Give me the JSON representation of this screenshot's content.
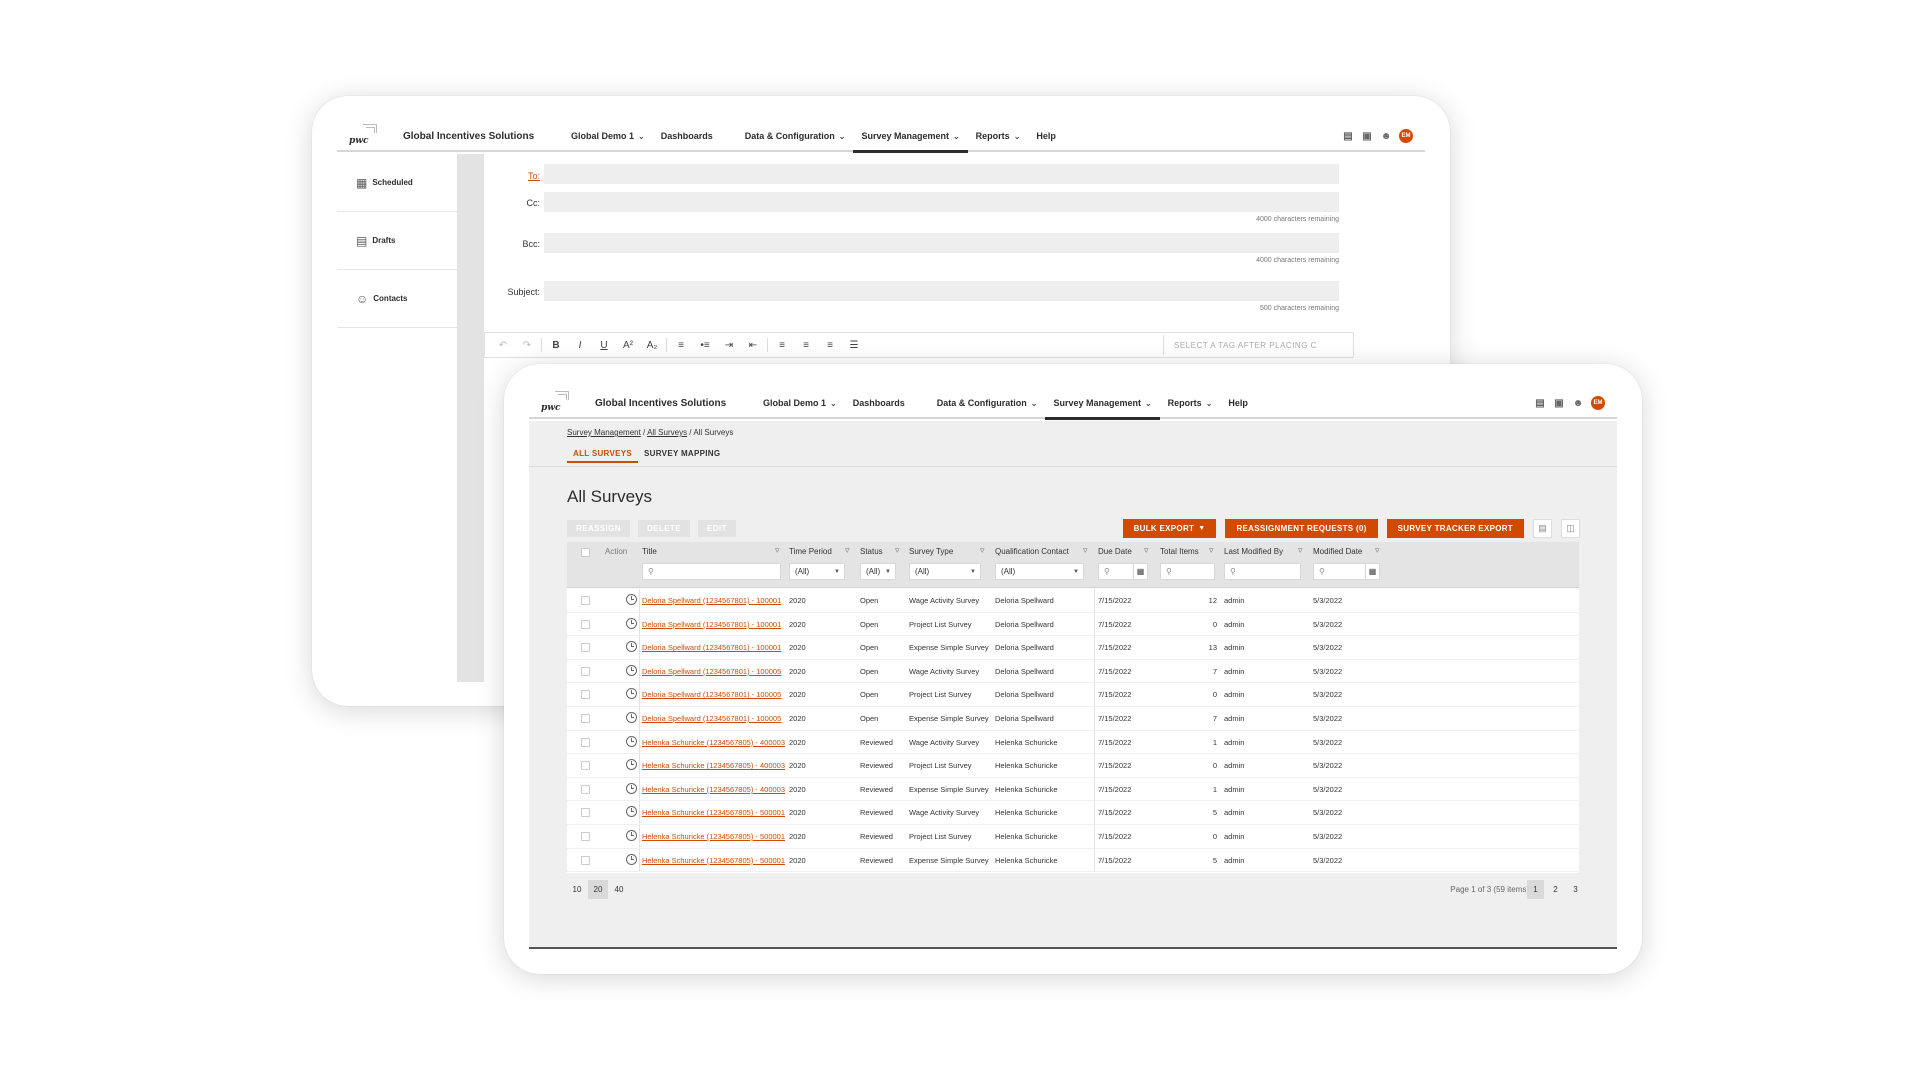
{
  "nav": {
    "logo_text": "pwc",
    "app_title": "Global Incentives Solutions",
    "items": [
      {
        "label": "Global Demo 1",
        "dropdown": true
      },
      {
        "label": "Dashboards",
        "dropdown": false
      },
      {
        "label": "Data & Configuration",
        "dropdown": true
      },
      {
        "label": "Survey Management",
        "dropdown": true,
        "active": true
      },
      {
        "label": "Reports",
        "dropdown": true
      },
      {
        "label": "Help",
        "dropdown": false
      }
    ],
    "icons": [
      "document-icon",
      "lock-icon",
      "users-icon"
    ],
    "avatar_initials": "EM",
    "accent_color": "#d04a02"
  },
  "back_screen": {
    "sidebar": [
      {
        "label": "Scheduled",
        "icon": "calendar-icon"
      },
      {
        "label": "Drafts",
        "icon": "document-icon"
      },
      {
        "label": "Contacts",
        "icon": "contacts-icon"
      }
    ],
    "form": {
      "to_label": "To:",
      "cc_label": "Cc:",
      "cc_hint": "4000 characters remaining",
      "bcc_label": "Bcc:",
      "bcc_hint": "4000 characters remaining",
      "subject_label": "Subject:",
      "subject_hint": "500 characters remaining"
    },
    "editor": {
      "tag_placeholder": "SELECT A TAG AFTER PLACING C"
    }
  },
  "front_screen": {
    "breadcrumb": {
      "level1": "Survey Management",
      "sep": " / ",
      "level2": "All Surveys",
      "current": "All Surveys"
    },
    "tabs": [
      {
        "label": "ALL SURVEYS",
        "active": true
      },
      {
        "label": "SURVEY MAPPING",
        "active": false
      }
    ],
    "title": "All Surveys",
    "disabled_actions": [
      "REASSIGN",
      "DELETE",
      "EDIT"
    ],
    "actions": {
      "bulk_export": "BULK EXPORT",
      "reassignment": "REASSIGNMENT REQUESTS (0)",
      "tracker_export": "SURVEY TRACKER EXPORT"
    },
    "table": {
      "columns": {
        "action": "Action",
        "title": "Title",
        "time_period": "Time Period",
        "status": "Status",
        "survey_type": "Survey Type",
        "qualification_contact": "Qualification Contact",
        "due_date": "Due Date",
        "total_items": "Total Items",
        "last_modified_by": "Last Modified By",
        "modified_date": "Modified Date"
      },
      "filters": {
        "time_period": "(All)",
        "status": "(All)",
        "survey_type": "(All)",
        "qualification_contact": "(All)"
      },
      "rows": [
        [
          "Deloria Spellward (1234567801) - 100001",
          "2020",
          "Open",
          "Wage Activity Survey",
          "Deloria Spellward",
          "7/15/2022",
          "12",
          "admin",
          "5/3/2022"
        ],
        [
          "Deloria Spellward (1234567801) - 100001",
          "2020",
          "Open",
          "Project List Survey",
          "Deloria Spellward",
          "7/15/2022",
          "0",
          "admin",
          "5/3/2022"
        ],
        [
          "Deloria Spellward (1234567801) - 100001",
          "2020",
          "Open",
          "Expense Simple Survey",
          "Deloria Spellward",
          "7/15/2022",
          "13",
          "admin",
          "5/3/2022"
        ],
        [
          "Deloria Spellward (1234567801) - 100005",
          "2020",
          "Open",
          "Wage Activity Survey",
          "Deloria Spellward",
          "7/15/2022",
          "7",
          "admin",
          "5/3/2022"
        ],
        [
          "Deloria Spellward (1234567801) - 100005",
          "2020",
          "Open",
          "Project List Survey",
          "Deloria Spellward",
          "7/15/2022",
          "0",
          "admin",
          "5/3/2022"
        ],
        [
          "Deloria Spellward (1234567801) - 100005",
          "2020",
          "Open",
          "Expense Simple Survey",
          "Deloria Spellward",
          "7/15/2022",
          "7",
          "admin",
          "5/3/2022"
        ],
        [
          "Helenka Schuricke (1234567805) - 400003",
          "2020",
          "Reviewed",
          "Wage Activity Survey",
          "Helenka Schuricke",
          "7/15/2022",
          "1",
          "admin",
          "5/3/2022"
        ],
        [
          "Helenka Schuricke (1234567805) - 400003",
          "2020",
          "Reviewed",
          "Project List Survey",
          "Helenka Schuricke",
          "7/15/2022",
          "0",
          "admin",
          "5/3/2022"
        ],
        [
          "Helenka Schuricke (1234567805) - 400003",
          "2020",
          "Reviewed",
          "Expense Simple Survey",
          "Helenka Schuricke",
          "7/15/2022",
          "1",
          "admin",
          "5/3/2022"
        ],
        [
          "Helenka Schuricke (1234567805) - 500001",
          "2020",
          "Reviewed",
          "Wage Activity Survey",
          "Helenka Schuricke",
          "7/15/2022",
          "5",
          "admin",
          "5/3/2022"
        ],
        [
          "Helenka Schuricke (1234567805) - 500001",
          "2020",
          "Reviewed",
          "Project List Survey",
          "Helenka Schuricke",
          "7/15/2022",
          "0",
          "admin",
          "5/3/2022"
        ],
        [
          "Helenka Schuricke (1234567805) - 500001",
          "2020",
          "Reviewed",
          "Expense Simple Survey",
          "Helenka Schuricke",
          "7/15/2022",
          "5",
          "admin",
          "5/3/2022"
        ]
      ]
    },
    "pager": {
      "sizes": [
        "10",
        "20",
        "40"
      ],
      "selected_size": "20",
      "info": "Page 1 of 3 (59 items)",
      "pages": [
        "1",
        "2",
        "3"
      ],
      "current_page": "1"
    }
  }
}
